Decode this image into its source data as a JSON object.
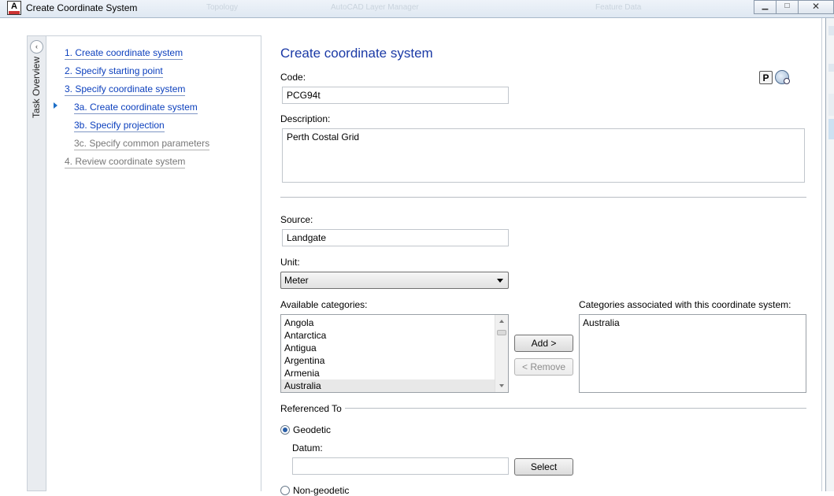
{
  "window": {
    "title": "Create Coordinate System",
    "icon_letter": "A",
    "background_tabs": [
      "Topology",
      "AutoCAD Layer Manager",
      "Feature Data"
    ],
    "controls": {
      "minimize": "▁",
      "maximize": "□",
      "close": "✕"
    }
  },
  "task_overview": {
    "label": "Task Overview",
    "collapse_glyph": "‹",
    "steps": [
      {
        "label": "1. Create coordinate system",
        "enabled": true
      },
      {
        "label": "2. Specify starting point",
        "enabled": true
      },
      {
        "label": "3. Specify coordinate system",
        "enabled": true
      },
      {
        "label": "3a. Create coordinate system",
        "enabled": true,
        "current": true
      },
      {
        "label": "3b. Specify projection",
        "enabled": true
      },
      {
        "label": "3c. Specify common parameters",
        "enabled": false
      },
      {
        "label": "4. Review coordinate system",
        "enabled": false
      }
    ]
  },
  "form": {
    "heading": "Create coordinate system",
    "code_label": "Code:",
    "code_value": "PCG94t",
    "description_label": "Description:",
    "description_value": "Perth Costal Grid",
    "toolbar_p_label": "P",
    "toolbar_icons": [
      "p-properties-icon",
      "globe-search-icon"
    ],
    "source_label": "Source:",
    "source_value": "Landgate",
    "unit_label": "Unit:",
    "unit_value": "Meter",
    "available_label": "Available categories:",
    "available_items": [
      "Angola",
      "Antarctica",
      "Antigua",
      "Argentina",
      "Armenia",
      "Australia"
    ],
    "available_selected": "Australia",
    "associated_label": "Categories associated with this coordinate system:",
    "associated_items": [
      "Australia"
    ],
    "add_button": "Add >",
    "remove_button": "< Remove",
    "referenced_label": "Referenced To",
    "geodetic_label": "Geodetic",
    "geodetic_selected": true,
    "datum_label": "Datum:",
    "datum_value": "",
    "select_button": "Select",
    "non_geodetic_label": "Non-geodetic"
  },
  "colors": {
    "link": "#0b3fbd",
    "heading": "#1b3aa6",
    "disabled": "#777777"
  }
}
